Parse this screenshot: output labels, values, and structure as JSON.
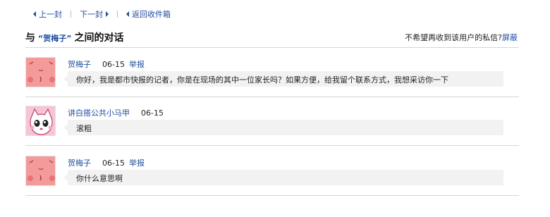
{
  "nav": {
    "prev": "上一封",
    "next": "下一封",
    "back": "返回收件箱"
  },
  "header": {
    "title_prefix": "与",
    "user": "“贺梅子”",
    "title_suffix": "之间的对话",
    "block_prompt": "不希望再收到该用户的私信?",
    "block_link": "屏蔽"
  },
  "messages": [
    {
      "sender": "贺梅子",
      "date": "06-15",
      "report": "举报",
      "text": "你好，我是都市快报的记者，你是在现场的其中一位家长吗？如果方便，给我留个联系方式，我想采访你一下",
      "avatar": "pink-face-avatar"
    },
    {
      "sender": "讲白搭公共小马甲",
      "date": "06-15",
      "report": "",
      "text": "滚粗",
      "avatar": "pink-cat-avatar"
    },
    {
      "sender": "贺梅子",
      "date": "06-15",
      "report": "举报",
      "text": "你什么意思啊",
      "avatar": "pink-face-avatar"
    }
  ],
  "colors": {
    "link": "#1f4e9e",
    "bubble": "#f2f2f2",
    "rule": "#d5d5d5",
    "avatar_pink": "#f39a9a"
  }
}
